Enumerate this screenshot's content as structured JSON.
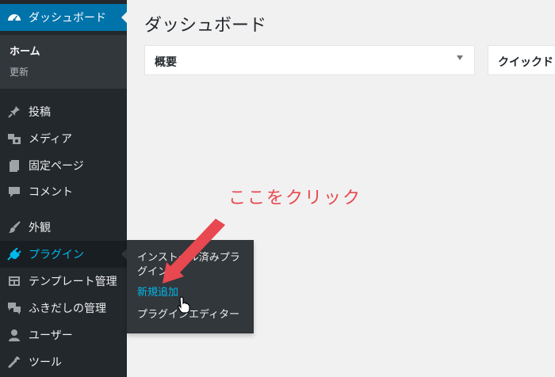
{
  "sidebar": {
    "dashboard": {
      "label": "ダッシュボード",
      "icon": "gauge-icon"
    },
    "submenu": {
      "home": "ホーム",
      "updates": "更新"
    },
    "items": [
      {
        "label": "投稿",
        "icon": "pin-icon"
      },
      {
        "label": "メディア",
        "icon": "media-icon"
      },
      {
        "label": "固定ページ",
        "icon": "page-icon"
      },
      {
        "label": "コメント",
        "icon": "comment-icon"
      },
      {
        "label": "外観",
        "icon": "brush-icon"
      },
      {
        "label": "プラグイン",
        "icon": "plugin-icon"
      },
      {
        "label": "テンプレート管理",
        "icon": "template-icon"
      },
      {
        "label": "ふきだしの管理",
        "icon": "balloon-icon"
      },
      {
        "label": "ユーザー",
        "icon": "user-icon"
      },
      {
        "label": "ツール",
        "icon": "wrench-icon"
      }
    ]
  },
  "flyout": {
    "installed": "インストール済みプラグイン",
    "add_new": "新規追加",
    "editor": "プラグインエディター"
  },
  "main": {
    "title": "ダッシュボード",
    "panels": [
      {
        "title": "概要"
      },
      {
        "title": "クイックド"
      }
    ]
  },
  "annotation": {
    "text": "ここをクリック"
  },
  "colors": {
    "sidebar_bg": "#23282d",
    "submenu_bg": "#32373c",
    "accent": "#0073aa",
    "hover_text": "#00b9eb",
    "annotation": "#e8484f",
    "page_bg": "#f1f1f1"
  }
}
